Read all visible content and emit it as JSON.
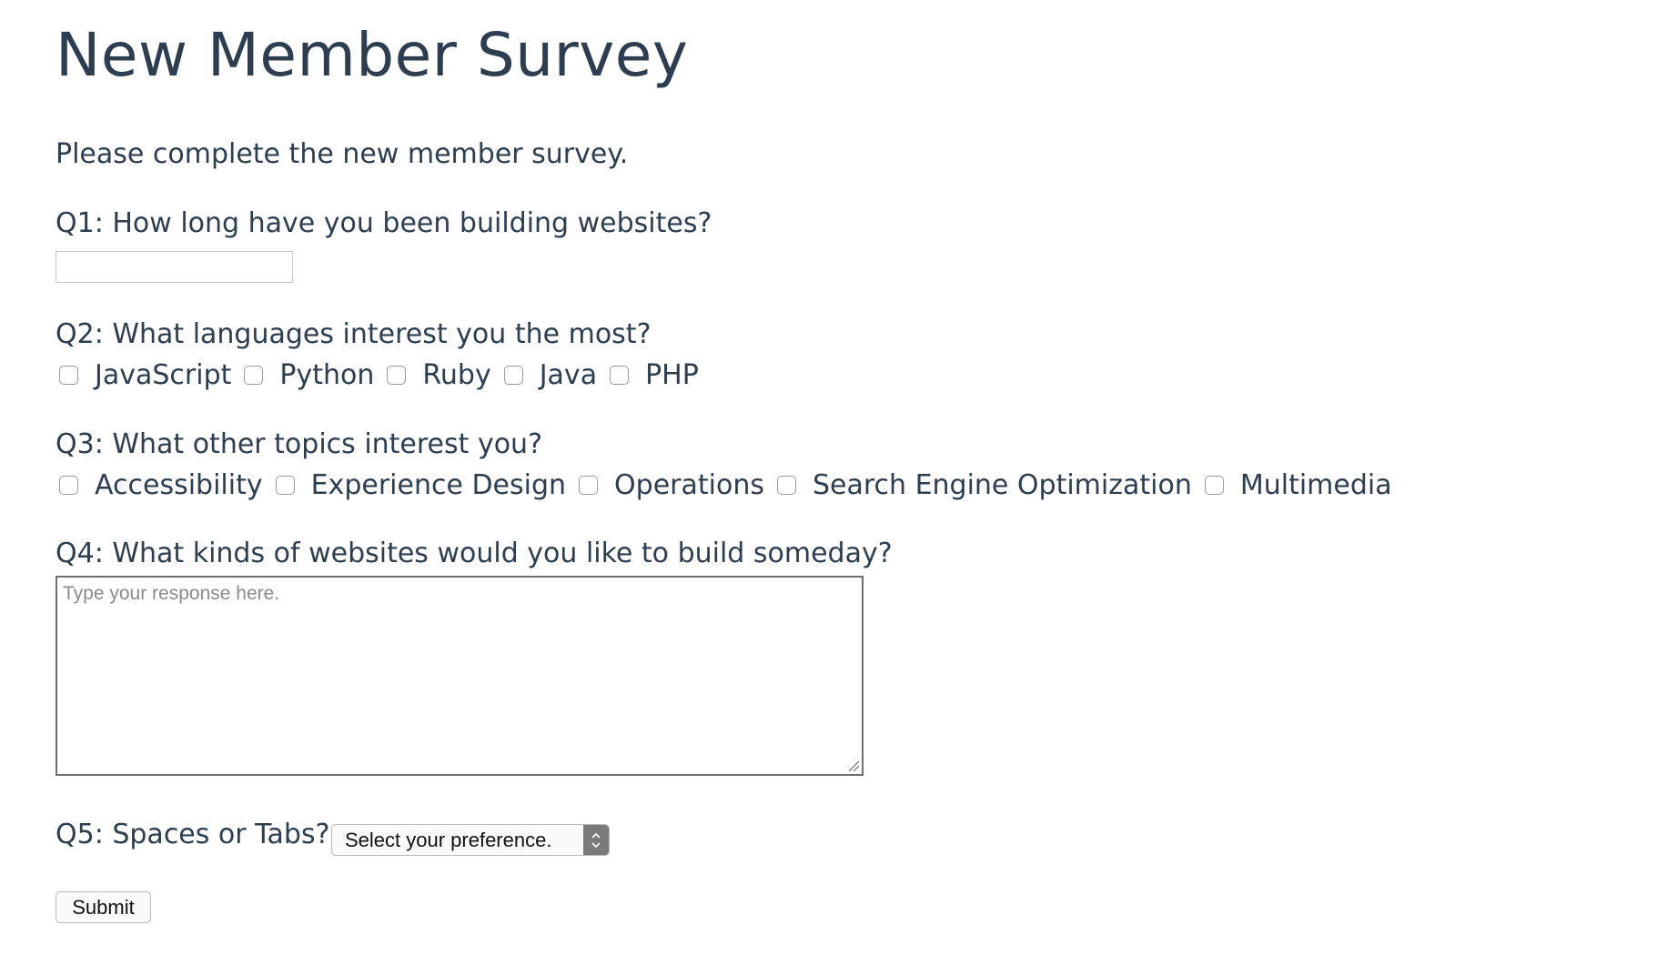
{
  "page": {
    "title": "New Member Survey",
    "intro": "Please complete the new member survey."
  },
  "q1": {
    "label": "Q1: How long have you been building websites?",
    "value": ""
  },
  "q2": {
    "label": "Q2: What languages interest you the most?",
    "options": [
      {
        "label": "JavaScript",
        "checked": false
      },
      {
        "label": "Python",
        "checked": false
      },
      {
        "label": "Ruby",
        "checked": false
      },
      {
        "label": "Java",
        "checked": false
      },
      {
        "label": "PHP",
        "checked": false
      }
    ]
  },
  "q3": {
    "label": "Q3: What other topics interest you?",
    "options": [
      {
        "label": "Accessibility",
        "checked": false
      },
      {
        "label": "Experience Design",
        "checked": false
      },
      {
        "label": "Operations",
        "checked": false
      },
      {
        "label": "Search Engine Optimization",
        "checked": false
      },
      {
        "label": "Multimedia",
        "checked": false
      }
    ]
  },
  "q4": {
    "label": "Q4: What kinds of websites would you like to build someday?",
    "placeholder": "Type your response here."
  },
  "q5": {
    "label": "Q5: Spaces or Tabs?",
    "selected": "Select your preference."
  },
  "submit": {
    "label": "Submit"
  },
  "colors": {
    "text": "#2c3e50",
    "background": "#ffffff"
  }
}
